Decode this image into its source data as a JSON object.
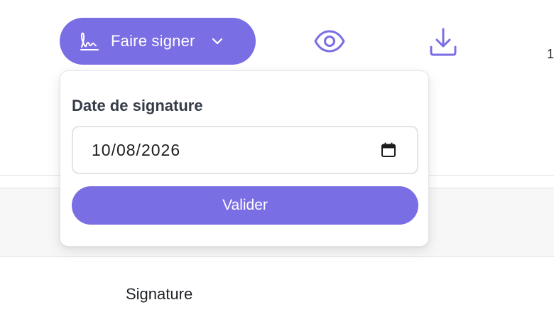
{
  "toolbar": {
    "sign_button_label": "Faire signer",
    "sign_icon": "signature-icon",
    "dropdown_icon": "chevron-down-icon",
    "preview_icon": "eye-icon",
    "download_icon": "download-icon",
    "accent_color": "#7a6ee4"
  },
  "popover": {
    "date_label": "Date de signature",
    "date_value": "10/08/2026",
    "calendar_icon": "calendar-icon",
    "submit_label": "Valider"
  },
  "page": {
    "partial_text": "1",
    "signature_column_label": "Signature"
  }
}
